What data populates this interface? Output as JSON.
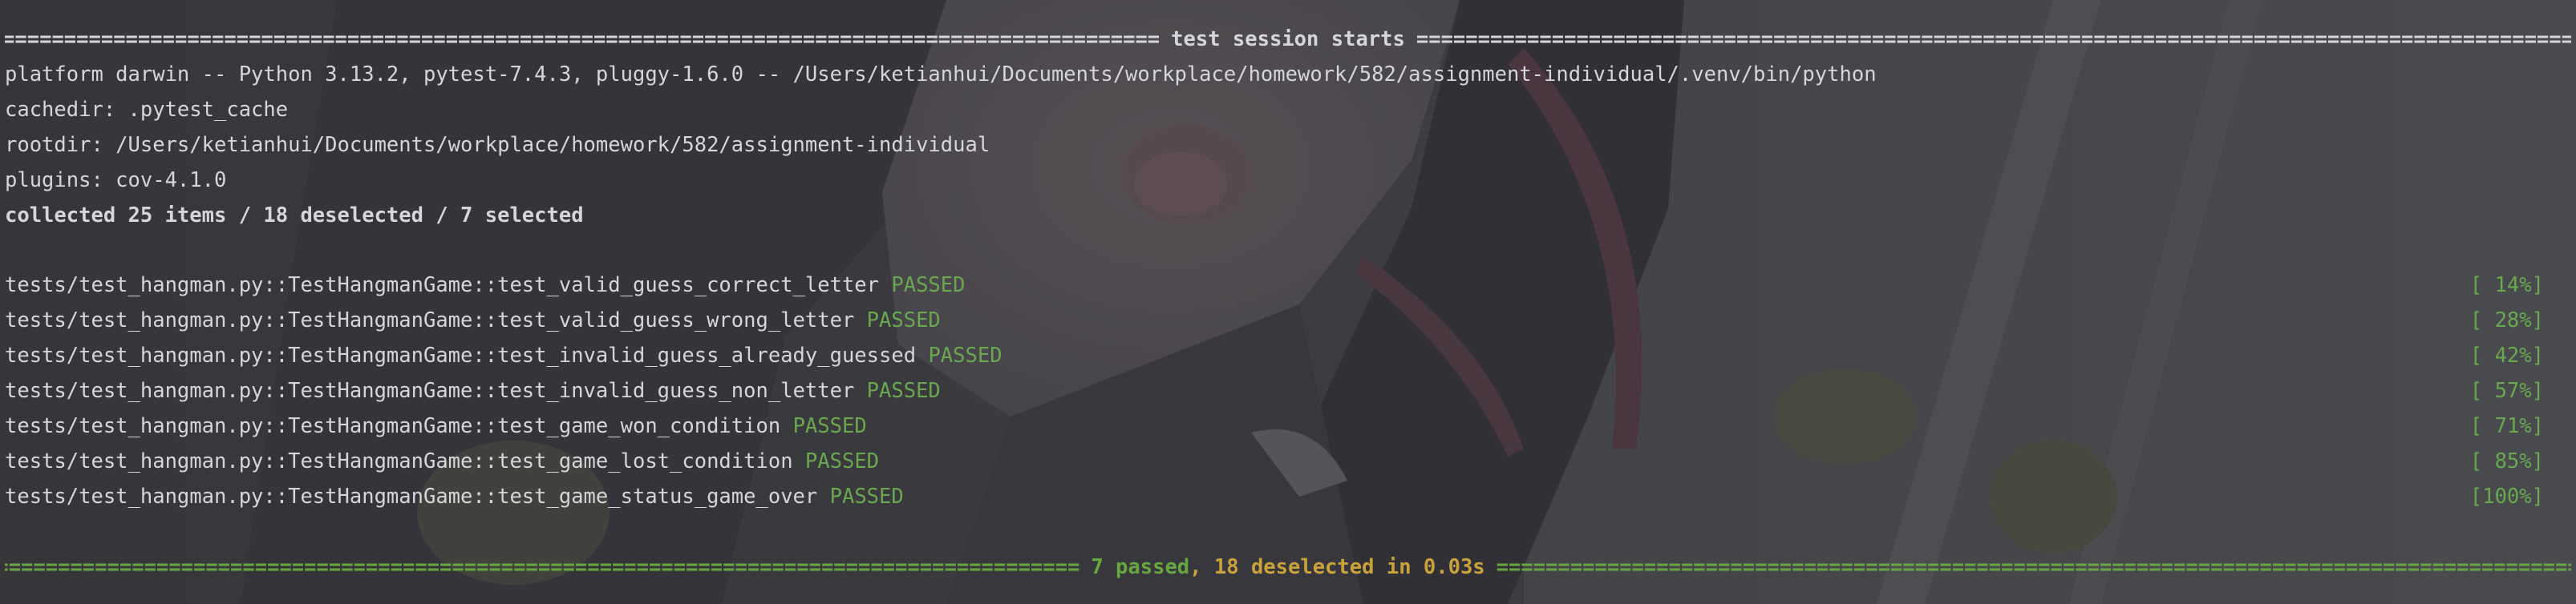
{
  "header": {
    "title": "test session starts",
    "eq_char": "="
  },
  "session": {
    "platform": "platform darwin -- Python 3.13.2, pytest-7.4.3, pluggy-1.6.0 -- /Users/ketianhui/Documents/workplace/homework/582/assignment-individual/.venv/bin/python",
    "cachedir": "cachedir: .pytest_cache",
    "rootdir": "rootdir: /Users/ketianhui/Documents/workplace/homework/582/assignment-individual",
    "plugins": "plugins: cov-4.1.0",
    "collected": "collected 25 items / 18 deselected / 7 selected"
  },
  "tests": [
    {
      "name": "tests/test_hangman.py::TestHangmanGame::test_valid_guess_correct_letter",
      "status": "PASSED",
      "progress": "[ 14%]"
    },
    {
      "name": "tests/test_hangman.py::TestHangmanGame::test_valid_guess_wrong_letter",
      "status": "PASSED",
      "progress": "[ 28%]"
    },
    {
      "name": "tests/test_hangman.py::TestHangmanGame::test_invalid_guess_already_guessed",
      "status": "PASSED",
      "progress": "[ 42%]"
    },
    {
      "name": "tests/test_hangman.py::TestHangmanGame::test_invalid_guess_non_letter",
      "status": "PASSED",
      "progress": "[ 57%]"
    },
    {
      "name": "tests/test_hangman.py::TestHangmanGame::test_game_won_condition",
      "status": "PASSED",
      "progress": "[ 71%]"
    },
    {
      "name": "tests/test_hangman.py::TestHangmanGame::test_game_lost_condition",
      "status": "PASSED",
      "progress": "[ 85%]"
    },
    {
      "name": "tests/test_hangman.py::TestHangmanGame::test_game_status_game_over",
      "status": "PASSED",
      "progress": "[100%]"
    }
  ],
  "summary": {
    "passed": "7 passed",
    "comma": ",",
    "deselected": "18 deselected",
    "time": "in 0.03s"
  },
  "colors": {
    "background": "#4a4b4e",
    "text": "#d4d6da",
    "passed": "#6aa84f",
    "warning": "#c9a23a"
  }
}
